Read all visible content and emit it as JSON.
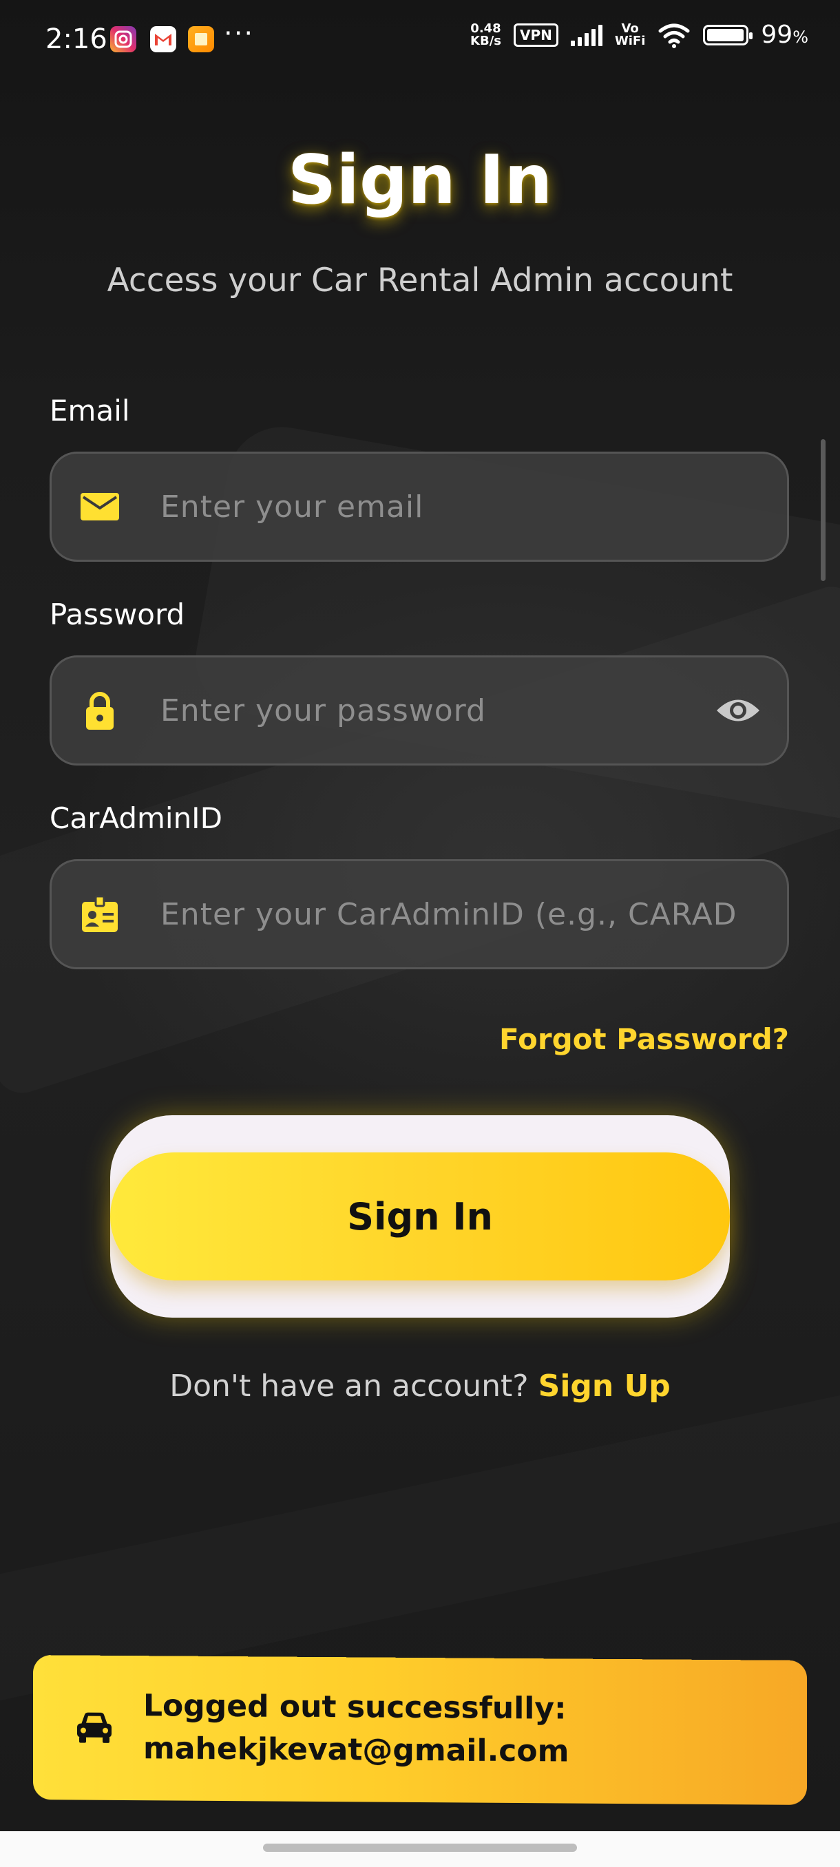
{
  "status_bar": {
    "time": "2:16",
    "net_speed_top": "0.48",
    "net_speed_bottom": "KB/s",
    "vpn": "VPN",
    "vowifi_top": "Vo",
    "vowifi_bottom": "WiFi",
    "battery_pct": "99",
    "battery_unit": "%",
    "more": "···",
    "notification_icons": [
      "instagram-icon",
      "gmail-icon",
      "notes-icon"
    ]
  },
  "header": {
    "title": "Sign In",
    "subtitle": "Access your Car Rental Admin account"
  },
  "form": {
    "email": {
      "label": "Email",
      "placeholder": "Enter your email",
      "value": "",
      "icon": "mail-icon"
    },
    "password": {
      "label": "Password",
      "placeholder": "Enter your password",
      "value": "",
      "icon": "lock-icon",
      "toggle_icon": "eye-icon"
    },
    "car_admin_id": {
      "label": "CarAdminID",
      "placeholder": "Enter your CarAdminID (e.g., CARAD...",
      "value": "",
      "icon": "id-badge-icon"
    },
    "forgot_password": "Forgot Password?",
    "submit_label": "Sign In"
  },
  "signup": {
    "prompt": "Don't have an account?",
    "link": "Sign Up"
  },
  "snackbar": {
    "icon": "car-icon",
    "line1": "Logged out successfully:",
    "line2": "mahekjkevat@gmail.com"
  },
  "colors": {
    "accent": "#FFD52E",
    "background": "#1B1B1B",
    "field_bg": "#3E3E3E"
  }
}
